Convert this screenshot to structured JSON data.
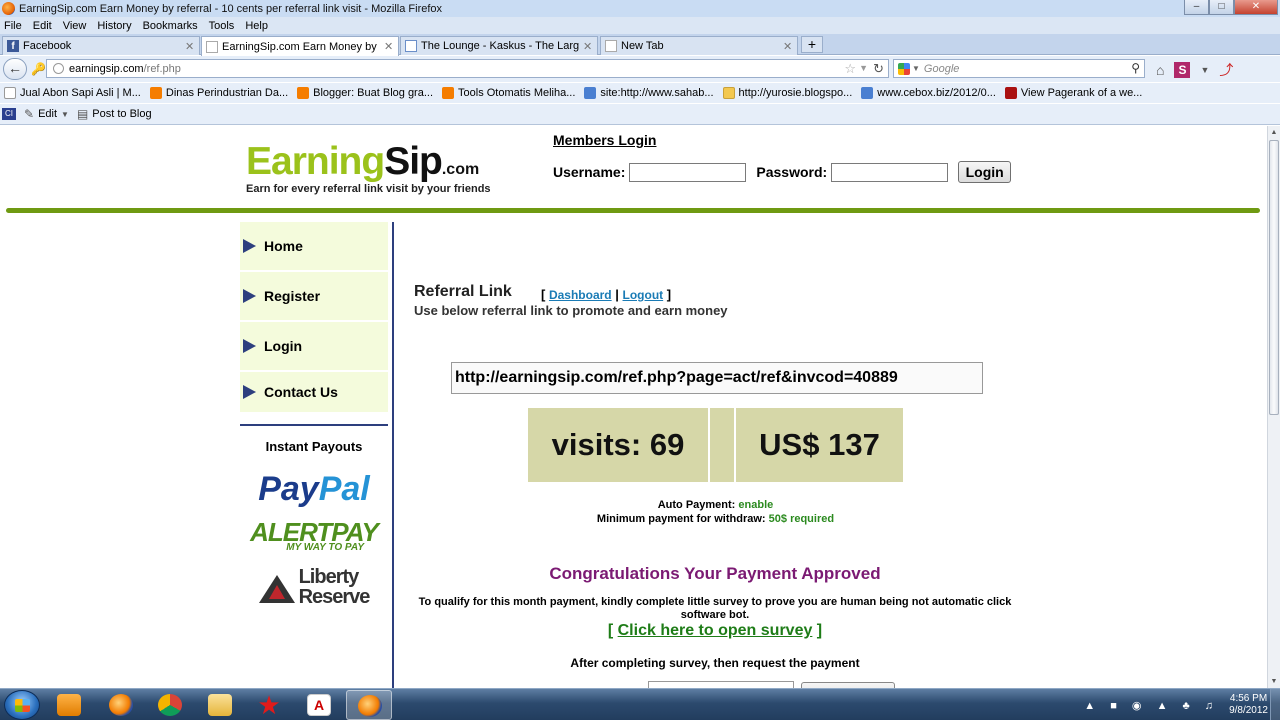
{
  "window": {
    "title": "EarningSip.com Earn Money by referral - 10 cents per referral link visit - Mozilla Firefox"
  },
  "menu": [
    "File",
    "Edit",
    "View",
    "History",
    "Bookmarks",
    "Tools",
    "Help"
  ],
  "tabs": [
    {
      "label": "Facebook",
      "icon": "facebook-icon"
    },
    {
      "label": "EarningSip.com Earn Money by referr...",
      "icon": "page-icon",
      "active": true
    },
    {
      "label": "The Lounge - Kaskus - The Largest In...",
      "icon": "kaskus-icon"
    },
    {
      "label": "New Tab",
      "icon": "page-icon"
    }
  ],
  "address": {
    "host": "earningsip.com",
    "path": "/ref.php",
    "search_placeholder": "Google"
  },
  "bookmarks": [
    {
      "label": "Jual Abon Sapi Asli | M...",
      "icon": "page"
    },
    {
      "label": "Dinas Perindustrian Da...",
      "icon": "blogger"
    },
    {
      "label": "Blogger: Buat Blog gra...",
      "icon": "blogger"
    },
    {
      "label": "Tools Otomatis Meliha...",
      "icon": "blogger"
    },
    {
      "label": "site:http://www.sahab...",
      "icon": "gsite"
    },
    {
      "label": "http://yurosie.blogspo...",
      "icon": "folder"
    },
    {
      "label": "www.cebox.biz/2012/0...",
      "icon": "gsite"
    },
    {
      "label": "View Pagerank of a we...",
      "icon": "red"
    }
  ],
  "toolbar2": {
    "ci_label": "CI",
    "edit_label": "Edit",
    "post_label": "Post to Blog"
  },
  "site": {
    "logo_earning": "Earning",
    "logo_sip": "Sip",
    "logo_com": ".com",
    "tagline": "Earn for every referral link visit by your friends",
    "members_login": "Members Login",
    "username_label": "Username:",
    "password_label": "Password:",
    "login_button": "Login"
  },
  "sidebar": {
    "items": [
      "Home",
      "Register",
      "Login",
      "Contact Us"
    ],
    "payouts_title": "Instant Payouts",
    "paypal_a": "Pay",
    "paypal_b": "Pal",
    "alertpay": "ALERTPAY",
    "alertpay_sub": "MY WAY TO PAY",
    "liberty_1": "Liberty",
    "liberty_2": "Reserve"
  },
  "main": {
    "ref_title": "Referral Link",
    "dashboard_link": "Dashboard",
    "logout_link": "Logout",
    "ref_desc": "Use below referral link to promote and earn money",
    "ref_url": "http://earningsip.com/ref.php?page=act/ref&invcod=40889",
    "visits": "visits: 69",
    "earnings": "US$ 137",
    "auto_payment_label": "Auto Payment:",
    "auto_payment_value": "enable",
    "min_payment_label": "Minimum payment for withdraw:",
    "min_payment_value": "50$ required",
    "congrats": "Congratulations Your Payment Approved",
    "qualify": "To qualify for this month payment, kindly complete little survey to prove you are human being not automatic click software bot.",
    "survey_link": "Click here to open survey",
    "after_survey": "After completing survey, then request the payment"
  },
  "taskbar": {
    "time": "4:56 PM",
    "date": "9/8/2012"
  }
}
